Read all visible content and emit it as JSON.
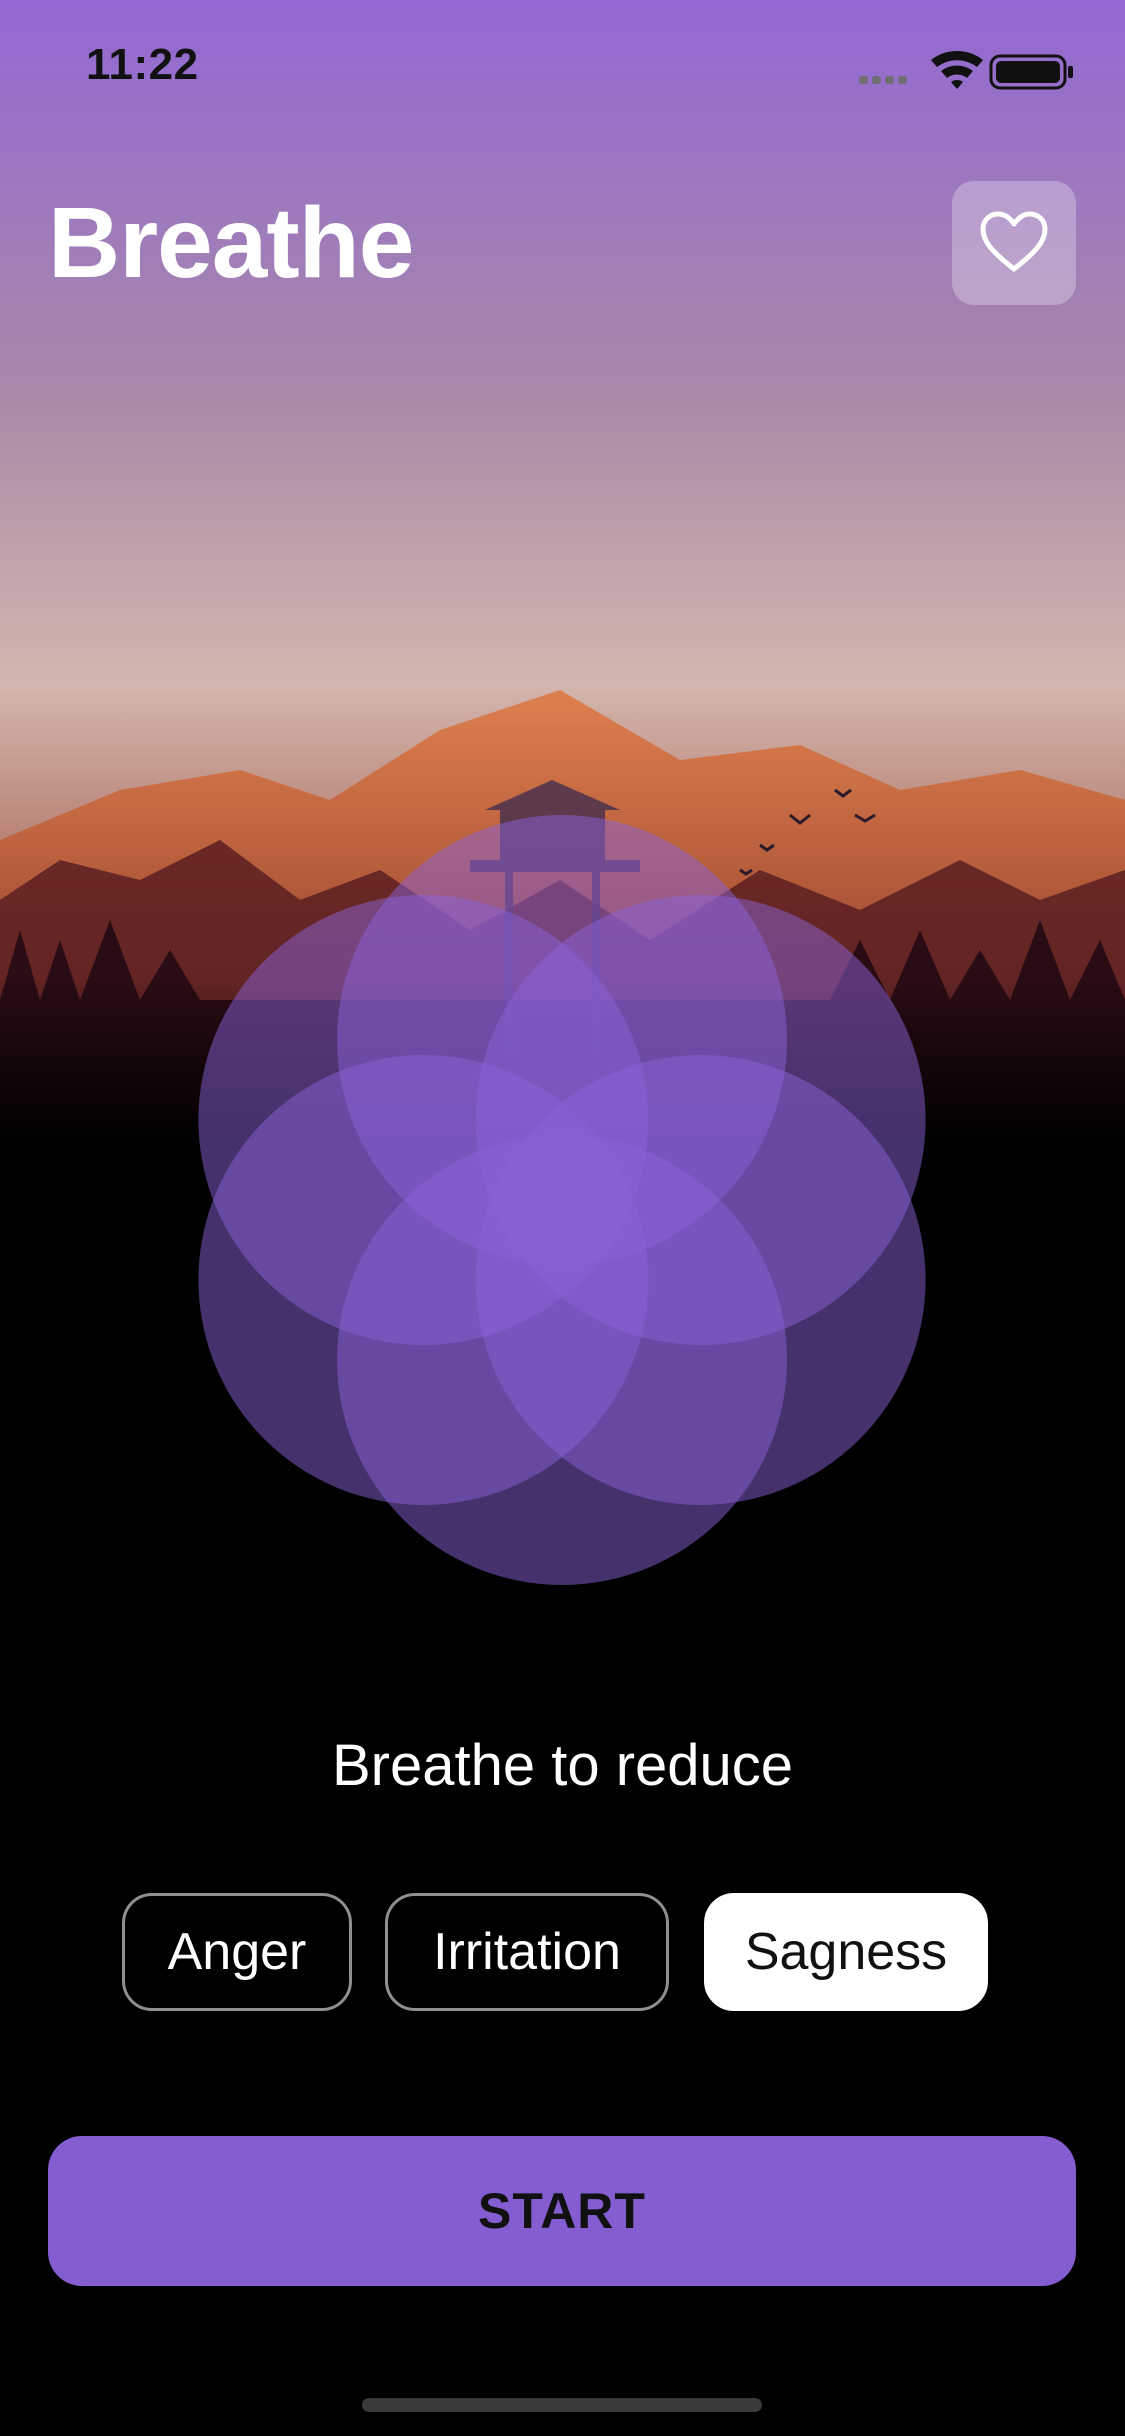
{
  "status_bar": {
    "time": "11:22"
  },
  "header": {
    "title": "Breathe",
    "favorite_icon": "heart-icon"
  },
  "main": {
    "prompt": "Breathe to reduce"
  },
  "emotions": {
    "options": [
      "Anger",
      "Irritation",
      "Sagness"
    ],
    "selected": "Sagness"
  },
  "actions": {
    "start_label": "START"
  },
  "colors": {
    "accent": "#845dd1",
    "petal": "#8a62d8",
    "sky_top": "#9268d3",
    "sky_mid": "#d3b6ad",
    "mountain": "#d86a3a"
  }
}
